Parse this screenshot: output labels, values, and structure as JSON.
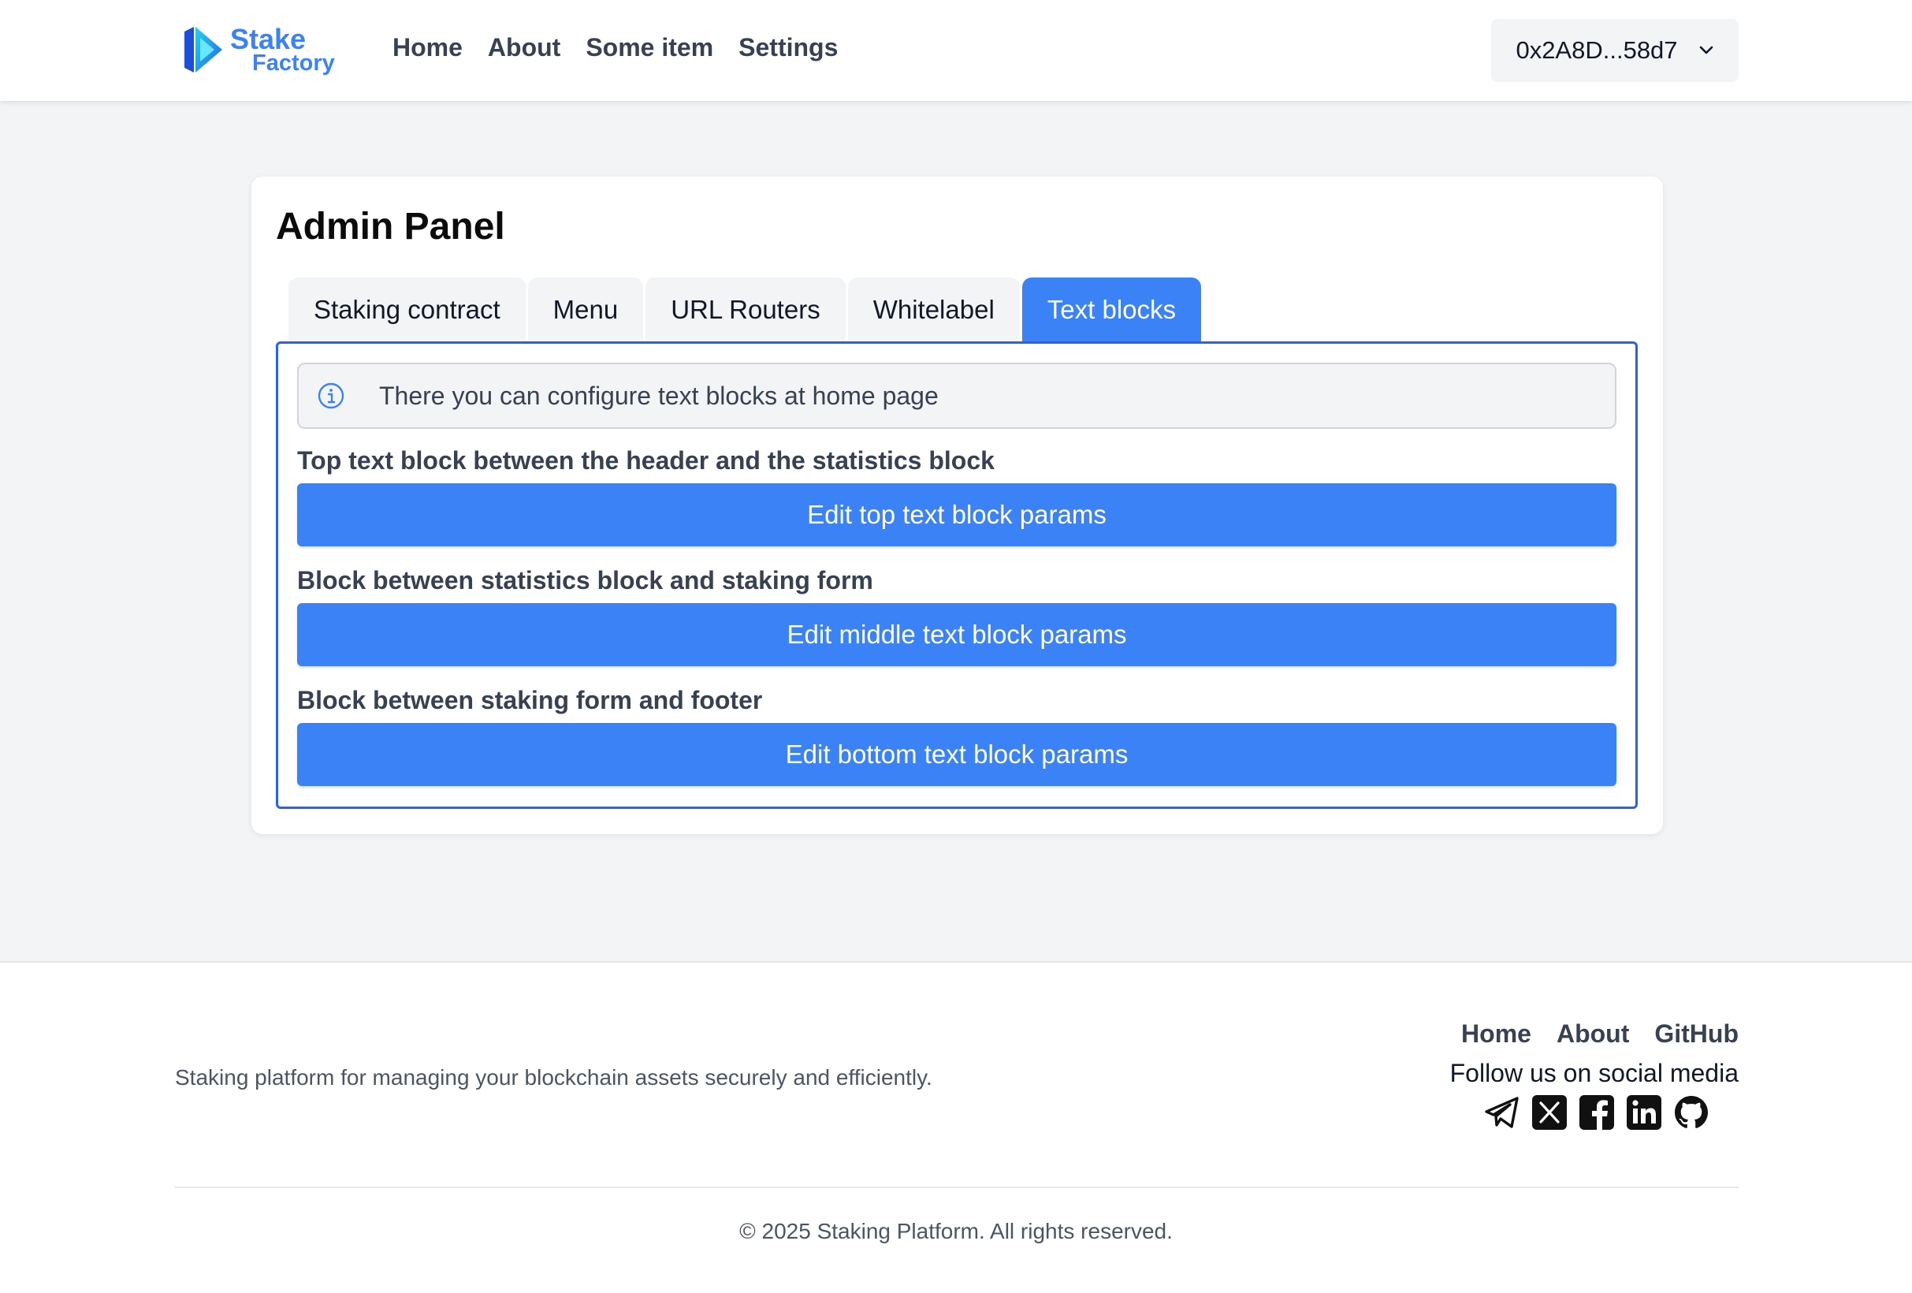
{
  "header": {
    "logo": {
      "line1": "Stake",
      "line2": "Factory"
    },
    "nav": [
      "Home",
      "About",
      "Some item",
      "Settings"
    ],
    "wallet": {
      "address": "0x2A8D...58d7"
    }
  },
  "admin": {
    "title": "Admin Panel",
    "tabs": [
      "Staking contract",
      "Menu",
      "URL Routers",
      "Whitelabel",
      "Text blocks"
    ],
    "active_tab": "Text blocks",
    "info": "There you can configure text blocks at home page",
    "blocks": [
      {
        "label": "Top text block between the header and the statistics block",
        "button": "Edit top text block params"
      },
      {
        "label": "Block between statistics block and staking form",
        "button": "Edit middle text block params"
      },
      {
        "label": "Block between staking form and footer",
        "button": "Edit bottom text block params"
      }
    ]
  },
  "footer": {
    "description": "Staking platform for managing your blockchain assets securely and efficiently.",
    "links": [
      "Home",
      "About",
      "GitHub"
    ],
    "follow": "Follow us on social media",
    "socials": [
      "telegram-icon",
      "x-icon",
      "facebook-icon",
      "linkedin-icon",
      "github-icon"
    ],
    "copyright": "© 2025 Staking Platform. All rights reserved."
  },
  "colors": {
    "accent": "#3b82f6",
    "panel_border": "#2563eb",
    "page_bg": "#f3f4f6"
  }
}
